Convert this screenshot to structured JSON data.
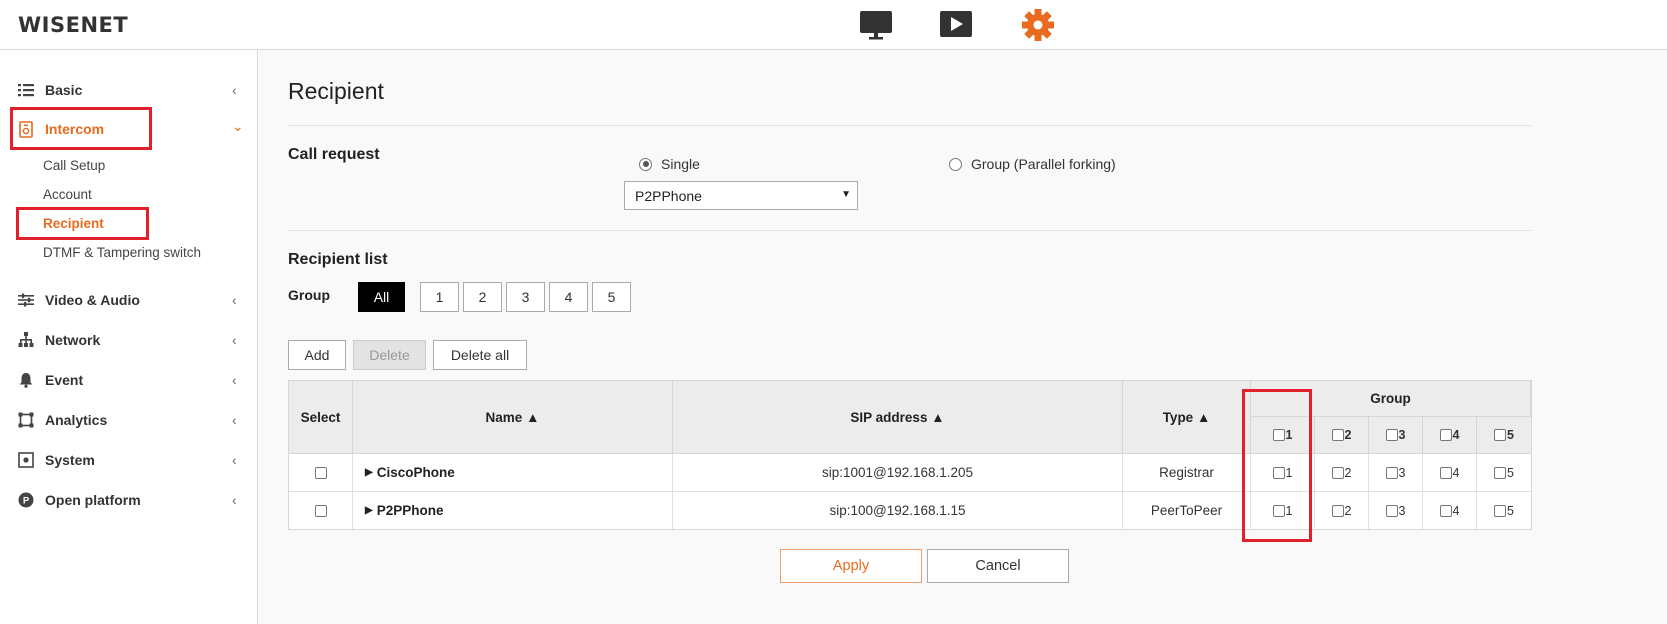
{
  "header": {
    "logo": "WISENET",
    "icons": [
      "monitor-icon",
      "playback-icon",
      "settings-gear-icon"
    ],
    "accent_color": "#e86b1f"
  },
  "sidebar": {
    "items": [
      {
        "label": "Basic",
        "icon": "list-icon",
        "chevron": "‹"
      },
      {
        "label": "Intercom",
        "icon": "intercom-icon",
        "chevron": "⌄"
      },
      {
        "label": "Video & Audio",
        "icon": "sliders-icon",
        "chevron": "‹"
      },
      {
        "label": "Network",
        "icon": "network-icon",
        "chevron": "‹"
      },
      {
        "label": "Event",
        "icon": "bell-icon",
        "chevron": "‹"
      },
      {
        "label": "Analytics",
        "icon": "analytics-frame-icon",
        "chevron": "‹"
      },
      {
        "label": "System",
        "icon": "system-icon",
        "chevron": "‹"
      },
      {
        "label": "Open platform",
        "icon": "open-platform-icon",
        "chevron": "‹"
      }
    ],
    "intercom_sub": [
      "Call Setup",
      "Account",
      "Recipient",
      "DTMF & Tampering switch"
    ]
  },
  "main": {
    "title": "Recipient",
    "call_request": {
      "label": "Call request",
      "option_single": "Single",
      "option_group": "Group (Parallel forking)",
      "selected_phone": "P2PPhone"
    },
    "recipient_list": {
      "label": "Recipient list",
      "group_label": "Group",
      "group_tabs": [
        "All",
        "1",
        "2",
        "3",
        "4",
        "5"
      ],
      "add_label": "Add",
      "delete_label": "Delete",
      "delete_all_label": "Delete all"
    },
    "table": {
      "headers": {
        "select": "Select",
        "name": "Name ▲",
        "sip": "SIP address ▲",
        "type": "Type ▲",
        "group": "Group"
      },
      "group_cols": [
        "1",
        "2",
        "3",
        "4",
        "5"
      ],
      "rows": [
        {
          "name": "CiscoPhone",
          "sip": "sip:1001@192.168.1.205",
          "type": "Registrar"
        },
        {
          "name": "P2PPhone",
          "sip": "sip:100@192.168.1.15",
          "type": "PeerToPeer"
        }
      ]
    },
    "apply_label": "Apply",
    "cancel_label": "Cancel"
  }
}
